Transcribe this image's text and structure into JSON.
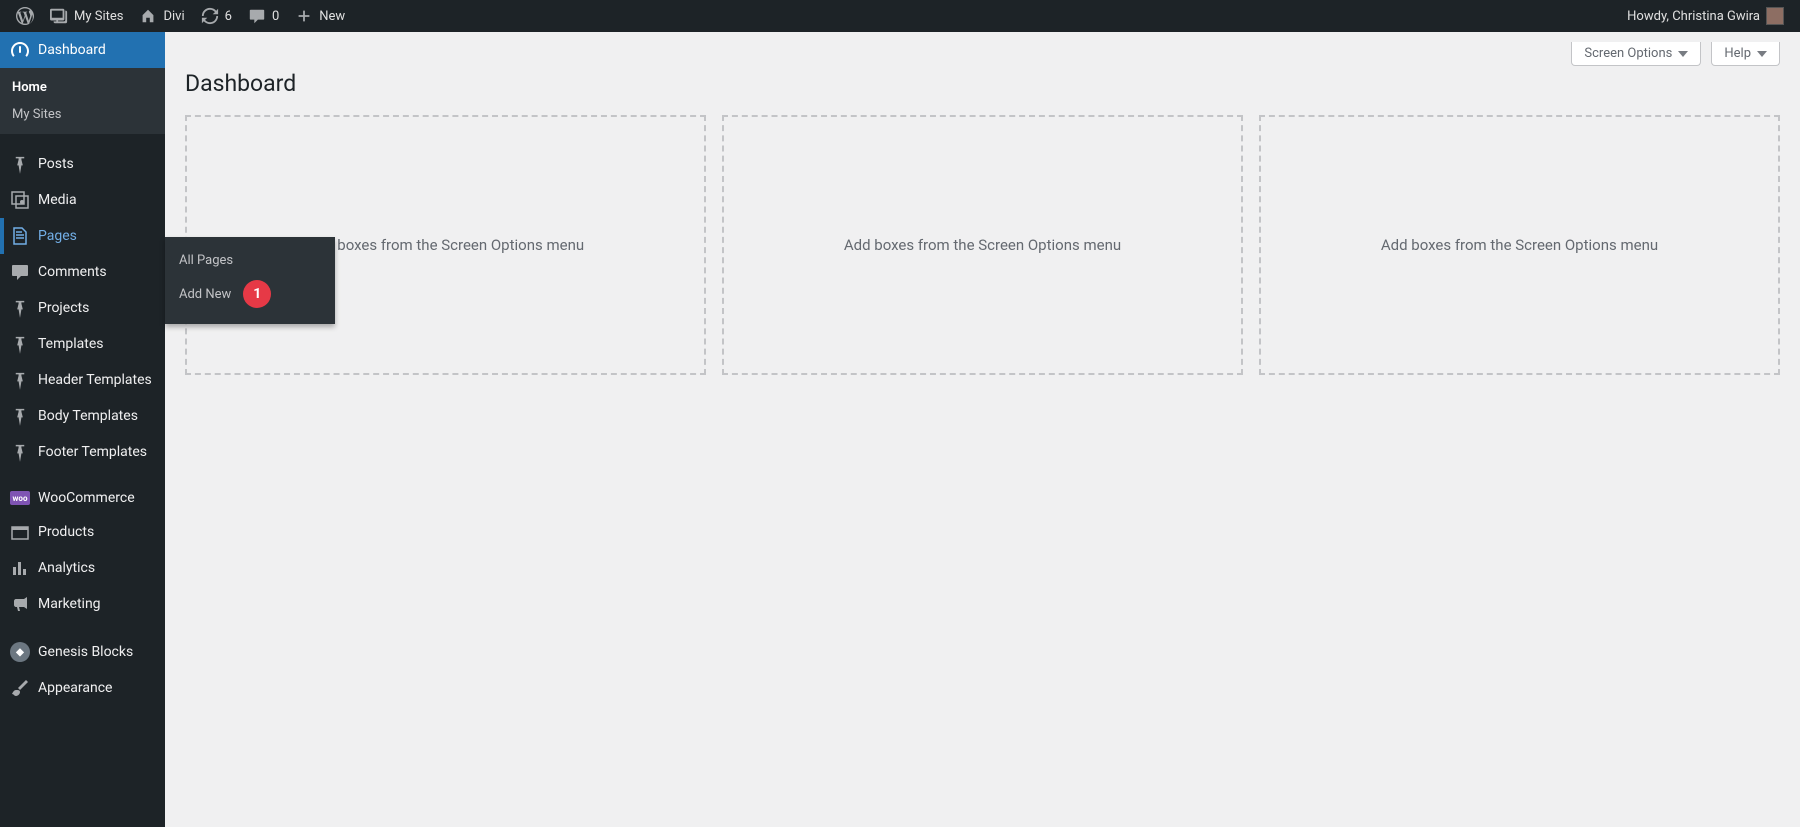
{
  "adminbar": {
    "my_sites": "My Sites",
    "site_name": "Divi",
    "updates_count": "6",
    "comments_count": "0",
    "new_label": "New",
    "howdy": "Howdy, Christina Gwira"
  },
  "sidebar": {
    "dashboard": "Dashboard",
    "submenu": {
      "home": "Home",
      "my_sites": "My Sites"
    },
    "items": {
      "posts": "Posts",
      "media": "Media",
      "pages": "Pages",
      "comments": "Comments",
      "projects": "Projects",
      "templates": "Templates",
      "header_templates": "Header Templates",
      "body_templates": "Body Templates",
      "footer_templates": "Footer Templates",
      "woocommerce": "WooCommerce",
      "products": "Products",
      "analytics": "Analytics",
      "marketing": "Marketing",
      "genesis_blocks": "Genesis Blocks",
      "appearance": "Appearance"
    },
    "pages_flyout": {
      "all_pages": "All Pages",
      "add_new": "Add New",
      "badge": "1"
    }
  },
  "main": {
    "screen_options": "Screen Options",
    "help": "Help",
    "title": "Dashboard",
    "placeholder_text": "Add boxes from the Screen Options menu"
  }
}
